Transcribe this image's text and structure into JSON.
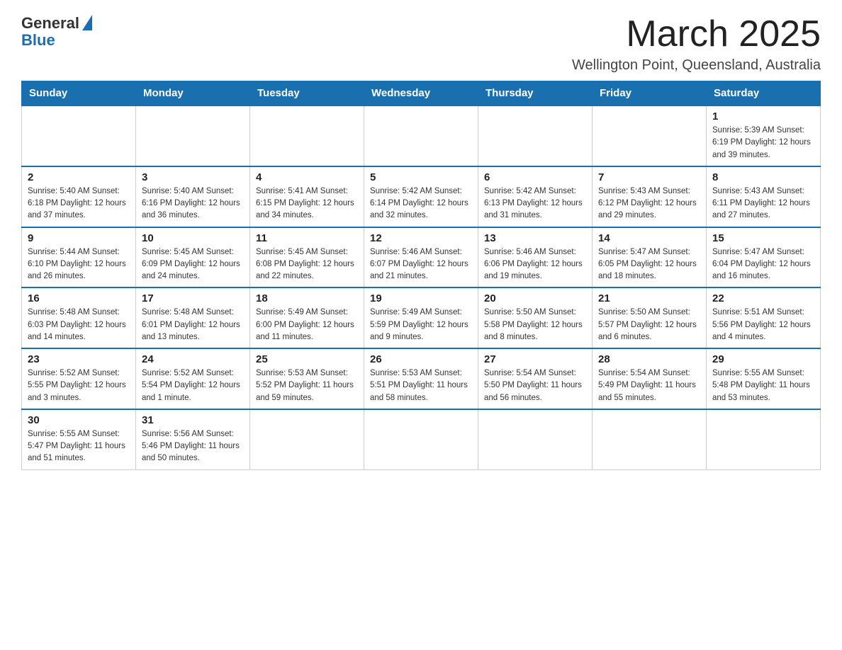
{
  "logo": {
    "general": "General",
    "blue": "Blue"
  },
  "title": "March 2025",
  "location": "Wellington Point, Queensland, Australia",
  "weekdays": [
    "Sunday",
    "Monday",
    "Tuesday",
    "Wednesday",
    "Thursday",
    "Friday",
    "Saturday"
  ],
  "weeks": [
    [
      {
        "day": "",
        "info": ""
      },
      {
        "day": "",
        "info": ""
      },
      {
        "day": "",
        "info": ""
      },
      {
        "day": "",
        "info": ""
      },
      {
        "day": "",
        "info": ""
      },
      {
        "day": "",
        "info": ""
      },
      {
        "day": "1",
        "info": "Sunrise: 5:39 AM\nSunset: 6:19 PM\nDaylight: 12 hours and 39 minutes."
      }
    ],
    [
      {
        "day": "2",
        "info": "Sunrise: 5:40 AM\nSunset: 6:18 PM\nDaylight: 12 hours and 37 minutes."
      },
      {
        "day": "3",
        "info": "Sunrise: 5:40 AM\nSunset: 6:16 PM\nDaylight: 12 hours and 36 minutes."
      },
      {
        "day": "4",
        "info": "Sunrise: 5:41 AM\nSunset: 6:15 PM\nDaylight: 12 hours and 34 minutes."
      },
      {
        "day": "5",
        "info": "Sunrise: 5:42 AM\nSunset: 6:14 PM\nDaylight: 12 hours and 32 minutes."
      },
      {
        "day": "6",
        "info": "Sunrise: 5:42 AM\nSunset: 6:13 PM\nDaylight: 12 hours and 31 minutes."
      },
      {
        "day": "7",
        "info": "Sunrise: 5:43 AM\nSunset: 6:12 PM\nDaylight: 12 hours and 29 minutes."
      },
      {
        "day": "8",
        "info": "Sunrise: 5:43 AM\nSunset: 6:11 PM\nDaylight: 12 hours and 27 minutes."
      }
    ],
    [
      {
        "day": "9",
        "info": "Sunrise: 5:44 AM\nSunset: 6:10 PM\nDaylight: 12 hours and 26 minutes."
      },
      {
        "day": "10",
        "info": "Sunrise: 5:45 AM\nSunset: 6:09 PM\nDaylight: 12 hours and 24 minutes."
      },
      {
        "day": "11",
        "info": "Sunrise: 5:45 AM\nSunset: 6:08 PM\nDaylight: 12 hours and 22 minutes."
      },
      {
        "day": "12",
        "info": "Sunrise: 5:46 AM\nSunset: 6:07 PM\nDaylight: 12 hours and 21 minutes."
      },
      {
        "day": "13",
        "info": "Sunrise: 5:46 AM\nSunset: 6:06 PM\nDaylight: 12 hours and 19 minutes."
      },
      {
        "day": "14",
        "info": "Sunrise: 5:47 AM\nSunset: 6:05 PM\nDaylight: 12 hours and 18 minutes."
      },
      {
        "day": "15",
        "info": "Sunrise: 5:47 AM\nSunset: 6:04 PM\nDaylight: 12 hours and 16 minutes."
      }
    ],
    [
      {
        "day": "16",
        "info": "Sunrise: 5:48 AM\nSunset: 6:03 PM\nDaylight: 12 hours and 14 minutes."
      },
      {
        "day": "17",
        "info": "Sunrise: 5:48 AM\nSunset: 6:01 PM\nDaylight: 12 hours and 13 minutes."
      },
      {
        "day": "18",
        "info": "Sunrise: 5:49 AM\nSunset: 6:00 PM\nDaylight: 12 hours and 11 minutes."
      },
      {
        "day": "19",
        "info": "Sunrise: 5:49 AM\nSunset: 5:59 PM\nDaylight: 12 hours and 9 minutes."
      },
      {
        "day": "20",
        "info": "Sunrise: 5:50 AM\nSunset: 5:58 PM\nDaylight: 12 hours and 8 minutes."
      },
      {
        "day": "21",
        "info": "Sunrise: 5:50 AM\nSunset: 5:57 PM\nDaylight: 12 hours and 6 minutes."
      },
      {
        "day": "22",
        "info": "Sunrise: 5:51 AM\nSunset: 5:56 PM\nDaylight: 12 hours and 4 minutes."
      }
    ],
    [
      {
        "day": "23",
        "info": "Sunrise: 5:52 AM\nSunset: 5:55 PM\nDaylight: 12 hours and 3 minutes."
      },
      {
        "day": "24",
        "info": "Sunrise: 5:52 AM\nSunset: 5:54 PM\nDaylight: 12 hours and 1 minute."
      },
      {
        "day": "25",
        "info": "Sunrise: 5:53 AM\nSunset: 5:52 PM\nDaylight: 11 hours and 59 minutes."
      },
      {
        "day": "26",
        "info": "Sunrise: 5:53 AM\nSunset: 5:51 PM\nDaylight: 11 hours and 58 minutes."
      },
      {
        "day": "27",
        "info": "Sunrise: 5:54 AM\nSunset: 5:50 PM\nDaylight: 11 hours and 56 minutes."
      },
      {
        "day": "28",
        "info": "Sunrise: 5:54 AM\nSunset: 5:49 PM\nDaylight: 11 hours and 55 minutes."
      },
      {
        "day": "29",
        "info": "Sunrise: 5:55 AM\nSunset: 5:48 PM\nDaylight: 11 hours and 53 minutes."
      }
    ],
    [
      {
        "day": "30",
        "info": "Sunrise: 5:55 AM\nSunset: 5:47 PM\nDaylight: 11 hours and 51 minutes."
      },
      {
        "day": "31",
        "info": "Sunrise: 5:56 AM\nSunset: 5:46 PM\nDaylight: 11 hours and 50 minutes."
      },
      {
        "day": "",
        "info": ""
      },
      {
        "day": "",
        "info": ""
      },
      {
        "day": "",
        "info": ""
      },
      {
        "day": "",
        "info": ""
      },
      {
        "day": "",
        "info": ""
      }
    ]
  ]
}
